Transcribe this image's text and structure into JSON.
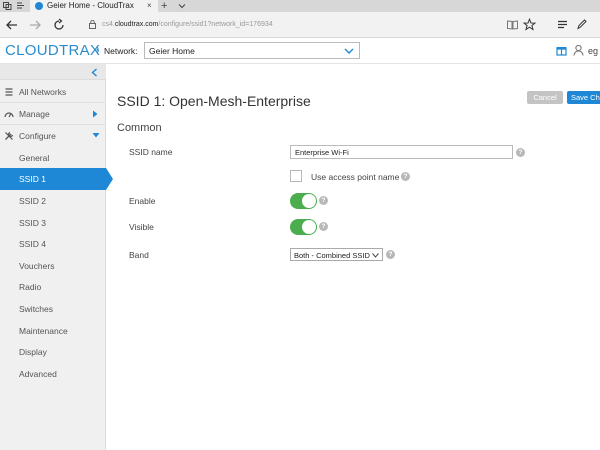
{
  "browser": {
    "tab_title": "Geier Home - CloudTrax",
    "new_tab": "+",
    "tab_close": "×",
    "address_prefix": "cs4.",
    "address_domain": "cloudtrax.com",
    "address_path": "/configure/ssid1?network_id=176934"
  },
  "header": {
    "logo": "CLOUDTRAX",
    "network_label": "Network:",
    "network_value": "Geier Home",
    "user_name": "eg"
  },
  "sidebar": {
    "items": [
      {
        "label": "All Networks"
      },
      {
        "label": "Manage"
      },
      {
        "label": "Configure"
      }
    ],
    "subitems": [
      {
        "label": "General"
      },
      {
        "label": "SSID 1"
      },
      {
        "label": "SSID 2"
      },
      {
        "label": "SSID 3"
      },
      {
        "label": "SSID 4"
      },
      {
        "label": "Vouchers"
      },
      {
        "label": "Radio"
      },
      {
        "label": "Switches"
      },
      {
        "label": "Maintenance"
      },
      {
        "label": "Display"
      },
      {
        "label": "Advanced"
      }
    ]
  },
  "main": {
    "title": "SSID 1: Open-Mesh-Enterprise",
    "cancel": "Cancel",
    "save": "Save Changes",
    "section": "Common",
    "ssid_name_label": "SSID name",
    "ssid_name_value": "Enterprise Wi-Fi",
    "use_ap_name_label": "Use access point name",
    "enable_label": "Enable",
    "visible_label": "Visible",
    "band_label": "Band",
    "band_value": "Both - Combined SSID",
    "help": "?"
  },
  "colors": {
    "accent": "#1e88d6",
    "toggle_on": "#4cad4f",
    "logo": "#2b8ccd"
  }
}
